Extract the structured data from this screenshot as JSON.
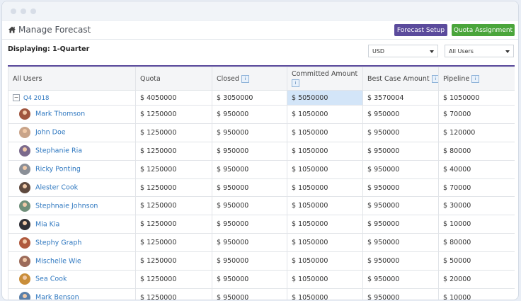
{
  "app": {
    "title": "Manage Forecast"
  },
  "toolbar": {
    "setup_label": "Forecast Setup",
    "quota_label": "Quota Assignment"
  },
  "colors": {
    "accent": "#5b4b9c",
    "quota_button": "#4aa53b",
    "link": "#2f78c0"
  },
  "displaying": "Displaying: 1-Quarter",
  "filters": {
    "currency": "USD",
    "users": "All Users"
  },
  "table": {
    "headers": {
      "users": "All Users",
      "quota": "Quota",
      "closed": "Closed",
      "committed": "Committed Amount",
      "best_case": "Best Case Amount",
      "pipeline": "Pipeline"
    },
    "info_icon": "i",
    "group": {
      "toggle": "−",
      "label": "Q4 2018",
      "quota": "$ 4050000",
      "closed": "$ 3050000",
      "committed": "$ 5050000",
      "best_case": "$ 3570004",
      "pipeline": "$ 1050000"
    },
    "rows": [
      {
        "name": "Mark Thomson",
        "quota": "$ 1250000",
        "closed": "$ 950000",
        "committed": "$ 1050000",
        "best_case": "$ 950000",
        "pipeline": "$ 70000",
        "avatar_color": "#a0563f"
      },
      {
        "name": "John Doe",
        "quota": "$ 1250000",
        "closed": "$ 950000",
        "committed": "$ 1050000",
        "best_case": "$ 950000",
        "pipeline": "$ 120000",
        "avatar_color": "#c9a489"
      },
      {
        "name": "Stephanie Ria",
        "quota": "$ 1250000",
        "closed": "$ 950000",
        "committed": "$ 1050000",
        "best_case": "$ 950000",
        "pipeline": "$ 80000",
        "avatar_color": "#7b6a8c"
      },
      {
        "name": "Ricky Ponting",
        "quota": "$ 1250000",
        "closed": "$ 950000",
        "committed": "$ 1050000",
        "best_case": "$ 950000",
        "pipeline": "$ 40000",
        "avatar_color": "#8a8f97"
      },
      {
        "name": "Alester Cook",
        "quota": "$ 1250000",
        "closed": "$ 950000",
        "committed": "$ 1050000",
        "best_case": "$ 950000",
        "pipeline": "$ 70000",
        "avatar_color": "#5f4a3f"
      },
      {
        "name": "Stephnaie Johnson",
        "quota": "$ 1250000",
        "closed": "$ 950000",
        "committed": "$ 1050000",
        "best_case": "$ 950000",
        "pipeline": "$ 30000",
        "avatar_color": "#6f8f7a"
      },
      {
        "name": "Mia Kia",
        "quota": "$ 1250000",
        "closed": "$ 950000",
        "committed": "$ 1050000",
        "best_case": "$ 950000",
        "pipeline": "$ 10000",
        "avatar_color": "#2f2f36"
      },
      {
        "name": "Stephy Graph",
        "quota": "$ 1250000",
        "closed": "$ 950000",
        "committed": "$ 1050000",
        "best_case": "$ 950000",
        "pipeline": "$ 80000",
        "avatar_color": "#b05a3e"
      },
      {
        "name": "Mischelle Wie",
        "quota": "$ 1250000",
        "closed": "$ 950000",
        "committed": "$ 1050000",
        "best_case": "$ 950000",
        "pipeline": "$ 50000",
        "avatar_color": "#9c6b5a"
      },
      {
        "name": "Sea Cook",
        "quota": "$ 1250000",
        "closed": "$ 950000",
        "committed": "$ 1050000",
        "best_case": "$ 950000",
        "pipeline": "$ 20000",
        "avatar_color": "#c98e3a"
      },
      {
        "name": "Mark Benson",
        "quota": "$ 1250000",
        "closed": "$ 950000",
        "committed": "$ 1050000",
        "best_case": "$ 950000",
        "pipeline": "$ 10000",
        "avatar_color": "#5a7fa8"
      }
    ]
  }
}
